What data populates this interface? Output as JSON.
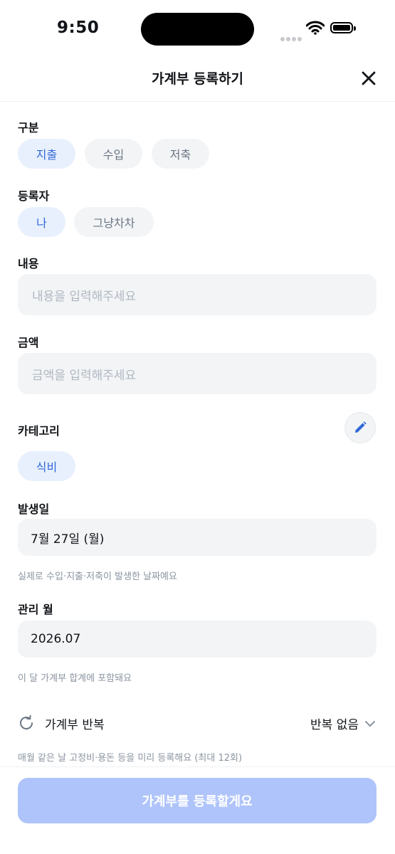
{
  "status_bar": {
    "time": "9:50"
  },
  "header": {
    "title": "가계부 등록하기"
  },
  "type_section": {
    "label": "구분",
    "options": [
      "지출",
      "수입",
      "저축"
    ],
    "selected": "지출"
  },
  "registrant_section": {
    "label": "등록자",
    "options": [
      "나",
      "그냥차차"
    ],
    "selected": "나"
  },
  "content_section": {
    "label": "내용",
    "placeholder": "내용을 입력해주세요",
    "value": ""
  },
  "amount_section": {
    "label": "금액",
    "placeholder": "금액을 입력해주세요",
    "value": ""
  },
  "category_section": {
    "label": "카테고리",
    "selected": "식비",
    "edit_icon": "pencil-icon"
  },
  "date_section": {
    "label": "발생일",
    "value": "7월 27일 (월)",
    "helper": "실제로 수입·지출·저축이 발생한 날짜예요"
  },
  "month_section": {
    "label": "관리 월",
    "value": "2026.07",
    "helper": "이 달 가계부 합계에 포함돼요"
  },
  "repeat_section": {
    "label": "가계부 반복",
    "value": "반복 없음",
    "helper": "매월 같은 날 고정비·용돈 등을 미리 등록해요 (최대 12회)",
    "icon": "repeat-icon"
  },
  "submit_button": {
    "label": "가계부를 등록할게요"
  },
  "colors": {
    "accent": "#3169d8",
    "chip_selected_bg": "#e8f0fd",
    "input_bg": "#f2f4f6",
    "submit_disabled": "#afc4fb"
  }
}
